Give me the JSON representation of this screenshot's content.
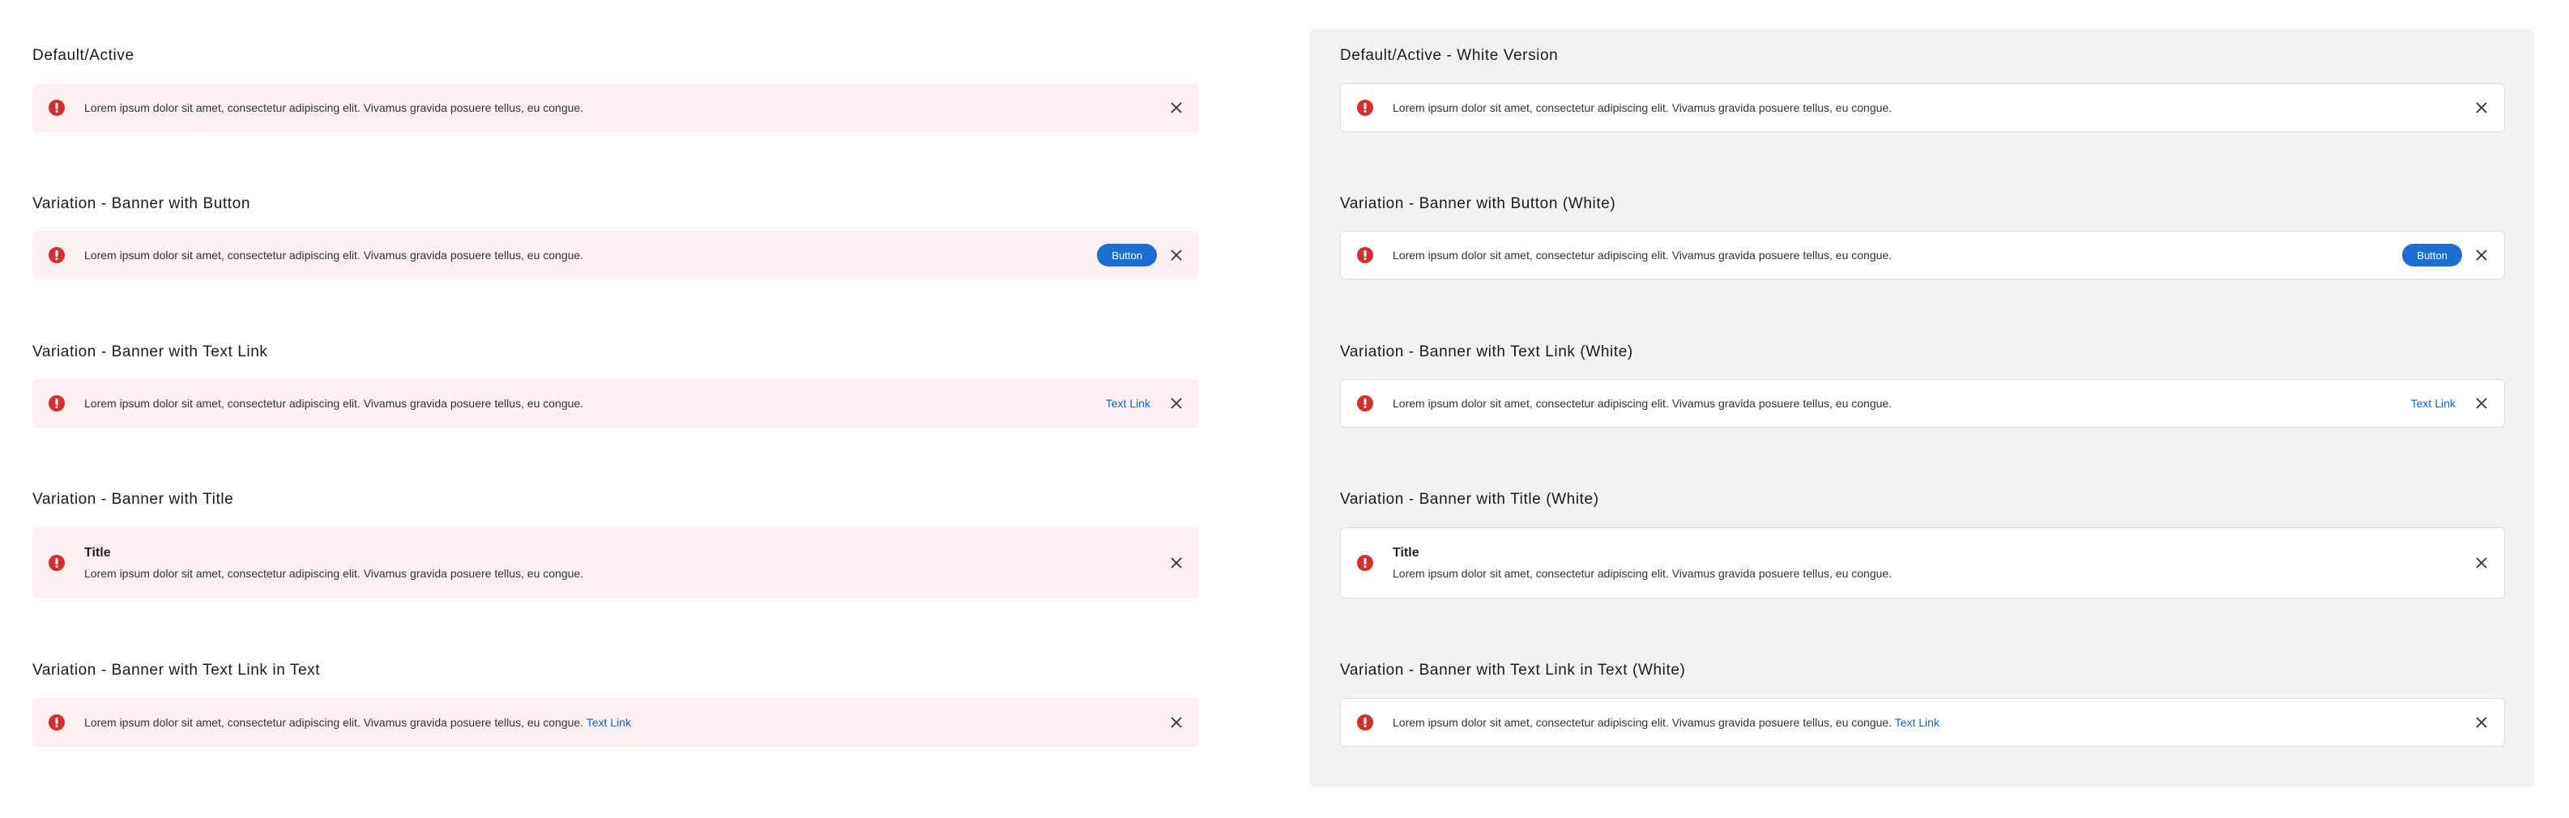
{
  "colors": {
    "pink_banner_bg": "#fcf0f0",
    "white_banner_bg": "#ffffff",
    "error_icon": "#d32f2f",
    "button_bg": "#1c6fd1",
    "link": "#1565c0",
    "panel_bg": "#f2f2f2"
  },
  "icons": {
    "error": "error-exclamation-icon",
    "close": "close-x-icon"
  },
  "left": {
    "headings": {
      "default": "Default/Active",
      "button": "Variation - Banner with Button",
      "text_link": "Variation - Banner with Text Link",
      "title": "Variation - Banner with Title",
      "link_in_text": "Variation - Banner with Text Link in Text"
    }
  },
  "right": {
    "headings": {
      "default": "Default/Active - White Version",
      "button": "Variation - Banner with Button (White)",
      "text_link": "Variation - Banner with Text Link (White)",
      "title": "Variation - Banner with Title (White)",
      "link_in_text": "Variation - Banner with Text Link in Text (White)"
    }
  },
  "banner": {
    "message": "Lorem ipsum dolor sit amet, consectetur adipiscing elit. Vivamus gravida posuere tellus, eu congue.",
    "title": "Title",
    "button_label": "Button",
    "link_label": "Text Link"
  }
}
